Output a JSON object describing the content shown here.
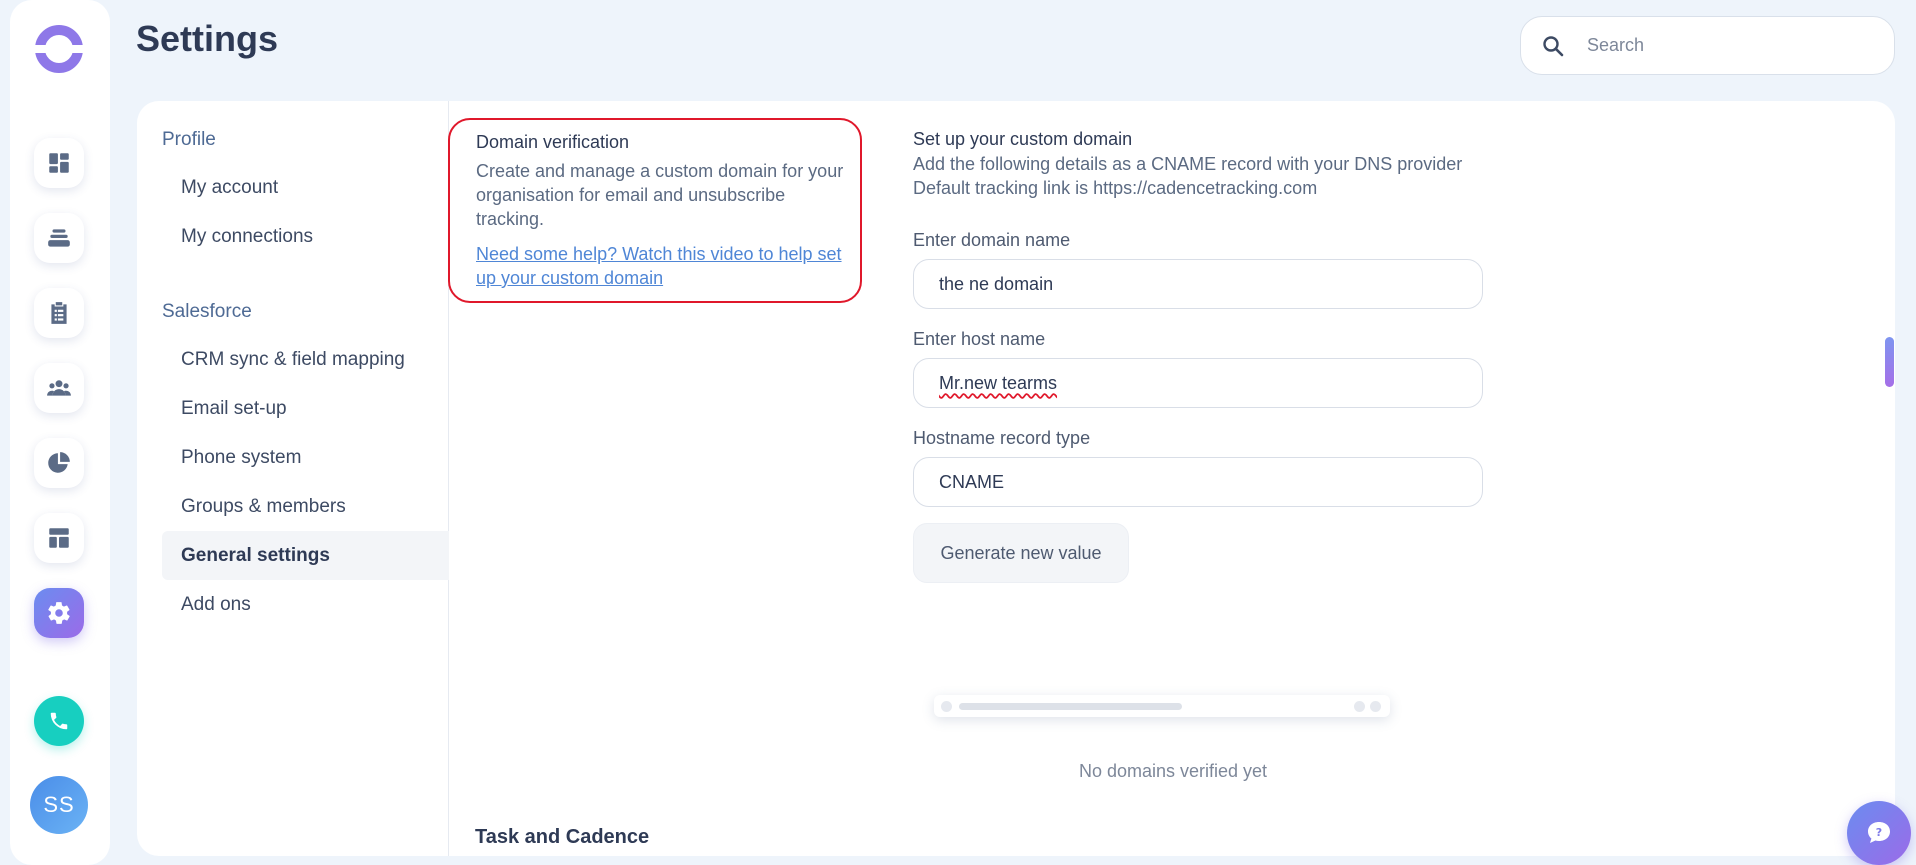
{
  "header": {
    "title": "Settings",
    "search_placeholder": "Search"
  },
  "rail": {
    "items": [
      {
        "icon": "dashboard-icon"
      },
      {
        "icon": "layers-icon"
      },
      {
        "icon": "clipboard-icon"
      },
      {
        "icon": "people-icon"
      },
      {
        "icon": "pie-chart-icon"
      },
      {
        "icon": "layout-icon"
      },
      {
        "icon": "gear-icon",
        "active": true
      },
      {
        "icon": "phone-icon"
      }
    ],
    "avatar_initials": "SS"
  },
  "subnav": {
    "profile_title": "Profile",
    "profile_items": [
      "My account",
      "My connections"
    ],
    "salesforce_title": "Salesforce",
    "salesforce_items": [
      "CRM sync & field mapping",
      "Email set-up",
      "Phone system",
      "Groups & members",
      "General settings",
      "Add ons"
    ],
    "active_item": "General settings"
  },
  "domain_verification": {
    "title": "Domain verification",
    "description": "Create and manage a custom domain for your organisation for email and unsubscribe tracking.",
    "help_link": "Need some help? Watch this video to help set up your custom domain"
  },
  "custom_domain": {
    "title": "Set up your custom domain",
    "subtitle_line1": "Add the following details as a CNAME record with your DNS provider",
    "subtitle_line2": "Default tracking link is https://cadencetracking.com",
    "domain_label": "Enter domain name",
    "domain_value": "the ne domain",
    "host_label": "Enter host name",
    "host_value": "Mr.new tearms",
    "record_label": "Hostname record type",
    "record_value": "CNAME",
    "generate_button": "Generate new value"
  },
  "empty_state": {
    "text": "No domains verified yet"
  },
  "next_section": {
    "title": "Task and Cadence"
  },
  "colors": {
    "accent_gradient_start": "#6b8cf0",
    "accent_gradient_end": "#9b6be8",
    "highlight_border": "#e0182b",
    "link": "#4f86d6",
    "phone": "#17cfc0"
  }
}
